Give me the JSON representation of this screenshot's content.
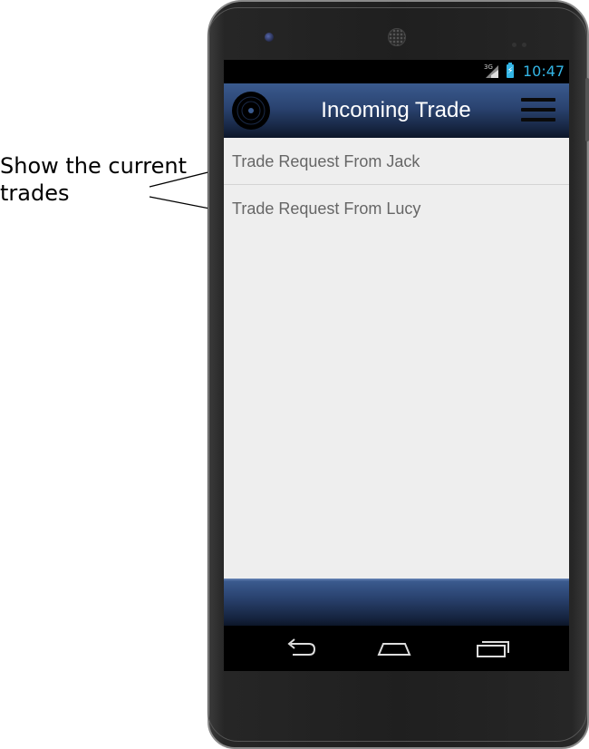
{
  "annotation": {
    "text": "Show the current trades"
  },
  "status_bar": {
    "network": "3G",
    "time": "10:47",
    "time_color": "#33b5e5"
  },
  "action_bar": {
    "title": "Incoming Trade",
    "logo_icon": "vinyl-record-icon",
    "menu_icon": "hamburger-menu-icon"
  },
  "trades": [
    {
      "label": "Trade Request From Jack"
    },
    {
      "label": "Trade Request From Lucy"
    }
  ],
  "navigation": {
    "back_icon": "back-icon",
    "home_icon": "home-icon",
    "recent_icon": "recent-apps-icon"
  },
  "colors": {
    "action_bar": "#2a4370",
    "content_background": "#eeeeee",
    "list_text": "#666666"
  }
}
